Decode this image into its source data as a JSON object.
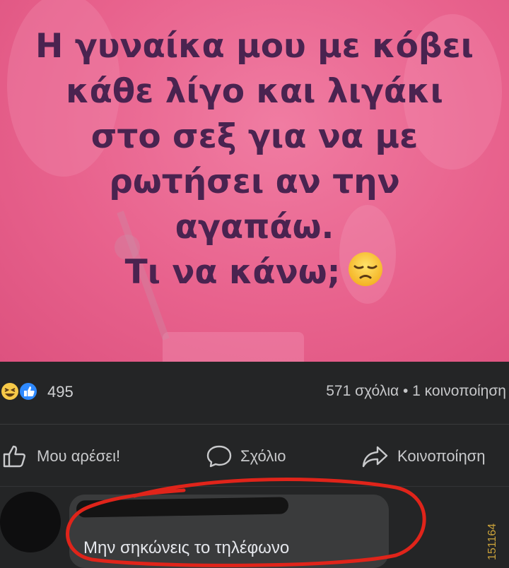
{
  "post": {
    "text_lines": [
      "Η γυναίκα μου με κόβει",
      "κάθε λίγο και λιγάκι",
      "στο σεξ για να με",
      "ρωτήσει αν την",
      "αγαπάω.",
      "Τι να κάνω;"
    ],
    "emoji": "pensive-face-emoji"
  },
  "stats": {
    "reaction_count": "495",
    "comments_shares": "571 σχόλια • 1 κοινοποίηση",
    "reaction_icons": [
      "haha-reaction-icon",
      "like-reaction-icon"
    ]
  },
  "actions": {
    "like_label": "Μου αρέσει!",
    "comment_label": "Σχόλιο",
    "share_label": "Κοινοποίηση"
  },
  "comment": {
    "text": "Μην σηκώνεις το τηλέφωνο"
  },
  "watermark": "151164",
  "colors": {
    "post_bg": "#e8628d",
    "post_text": "#4a2350",
    "dark_bg": "#242526",
    "bubble": "#3a3b3c",
    "annotation_red": "#e0241a",
    "like_blue": "#2e89ff"
  }
}
